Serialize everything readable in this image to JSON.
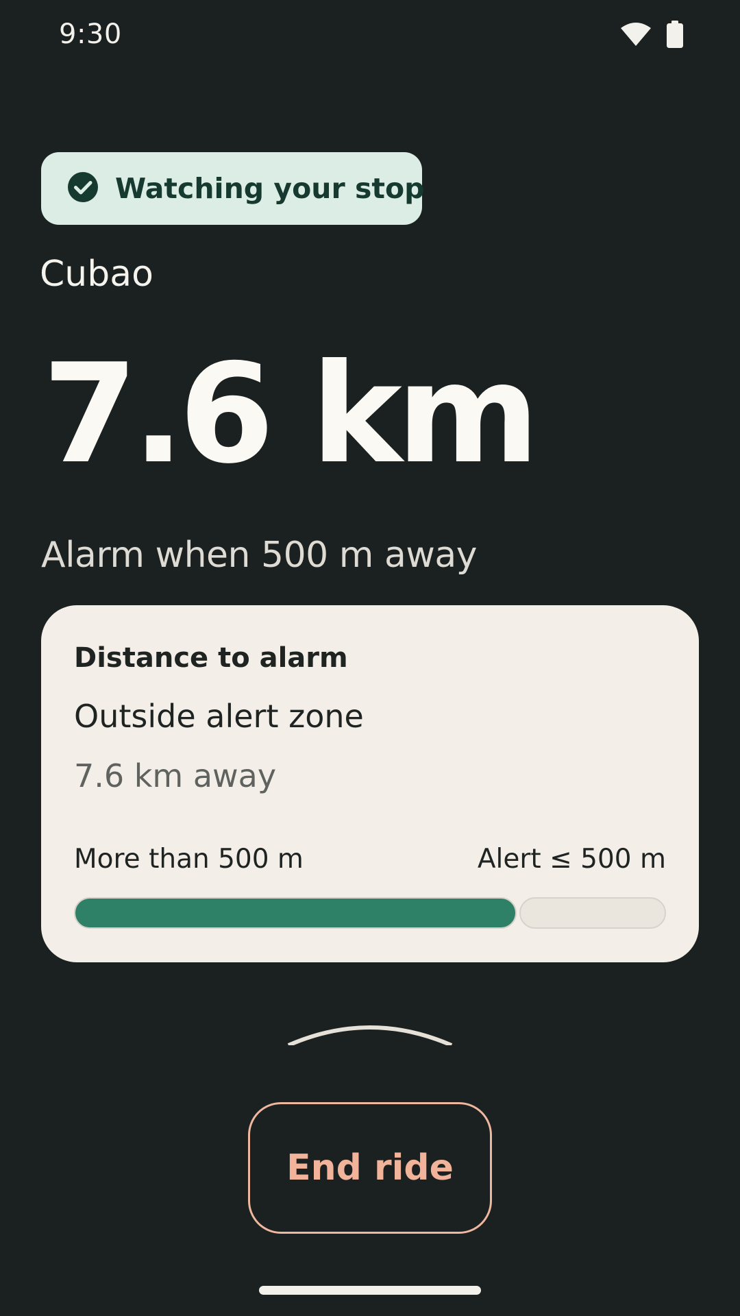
{
  "status_bar": {
    "time": "9:30",
    "icons": [
      "wifi-icon",
      "battery-icon"
    ]
  },
  "chip": {
    "icon": "check-circle-icon",
    "label": "Watching your stop"
  },
  "stop": {
    "name": "Cubao",
    "distance": "7.6 km",
    "alarm_text": "Alarm when 500 m away"
  },
  "card": {
    "title": "Distance to alarm",
    "status": "Outside alert zone",
    "away": "7.6 km away",
    "range_left": "More than 500 m",
    "range_right": "Alert ≤ 500 m",
    "progress_fraction": 0.75
  },
  "actions": {
    "end_ride": "End ride"
  },
  "colors": {
    "background": "#1a2120",
    "chip_background": "#dcede5",
    "chip_text": "#173a30",
    "card_background": "#f3efe8",
    "progress_fill": "#2e8166",
    "end_button_accent": "#f1b39a"
  }
}
